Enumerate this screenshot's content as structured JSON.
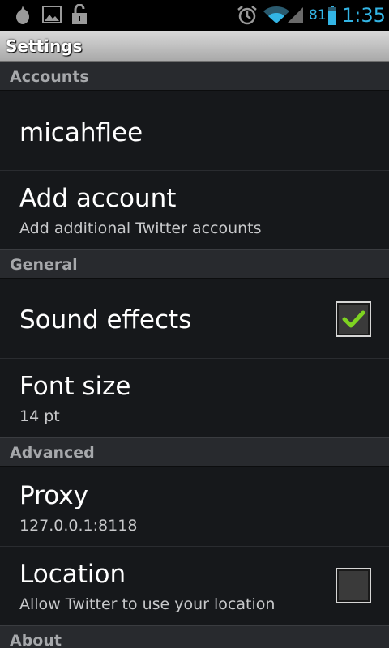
{
  "status_bar": {
    "icons": [
      "drop-icon",
      "image-icon",
      "lock-icon",
      "alarm-icon",
      "wifi-icon",
      "signal-icon",
      "battery-icon"
    ],
    "battery_percent": "81",
    "time": "1:35",
    "accent_color": "#33b5e5"
  },
  "title": "Settings",
  "sections": {
    "accounts": {
      "label": "Accounts",
      "items": [
        {
          "title": "micahflee"
        },
        {
          "title": "Add account",
          "summary": "Add additional Twitter accounts"
        }
      ]
    },
    "general": {
      "label": "General",
      "sound_effects": {
        "title": "Sound effects",
        "checked": true
      },
      "font_size": {
        "title": "Font size",
        "summary": "14 pt"
      }
    },
    "advanced": {
      "label": "Advanced",
      "proxy": {
        "title": "Proxy",
        "summary": "127.0.0.1:8118"
      },
      "location": {
        "title": "Location",
        "summary": "Allow Twitter to use your location",
        "checked": false
      }
    },
    "about": {
      "label": "About"
    }
  },
  "checkmark_color": "#7ed321"
}
